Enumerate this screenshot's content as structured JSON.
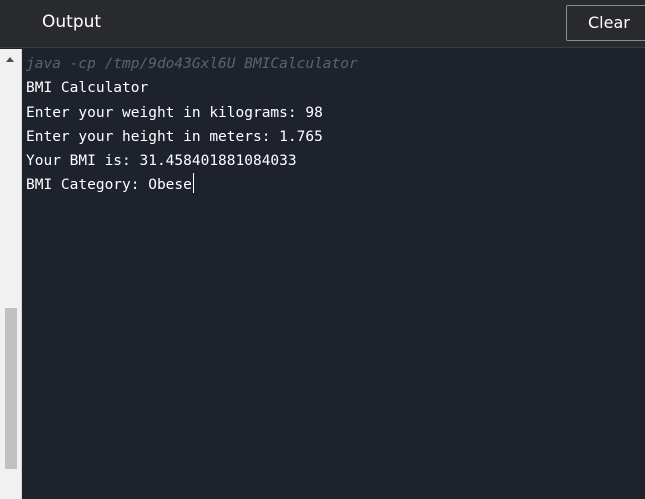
{
  "header": {
    "title": "Output",
    "clear_label": "Clear"
  },
  "console": {
    "command": "java -cp /tmp/9do43Gxl6U BMICalculator",
    "lines": [
      "BMI Calculator",
      "Enter your weight in kilograms: 98",
      "Enter your height in meters: 1.765",
      "Your BMI is: 31.458401881084033",
      "BMI Category: Obese"
    ]
  },
  "icons": {
    "scroll_up": "arrow-up-icon"
  },
  "colors": {
    "console_bg": "#1d222d",
    "header_bg": "#292a2e",
    "command_text": "#5e626b",
    "output_text": "#ffffff"
  }
}
